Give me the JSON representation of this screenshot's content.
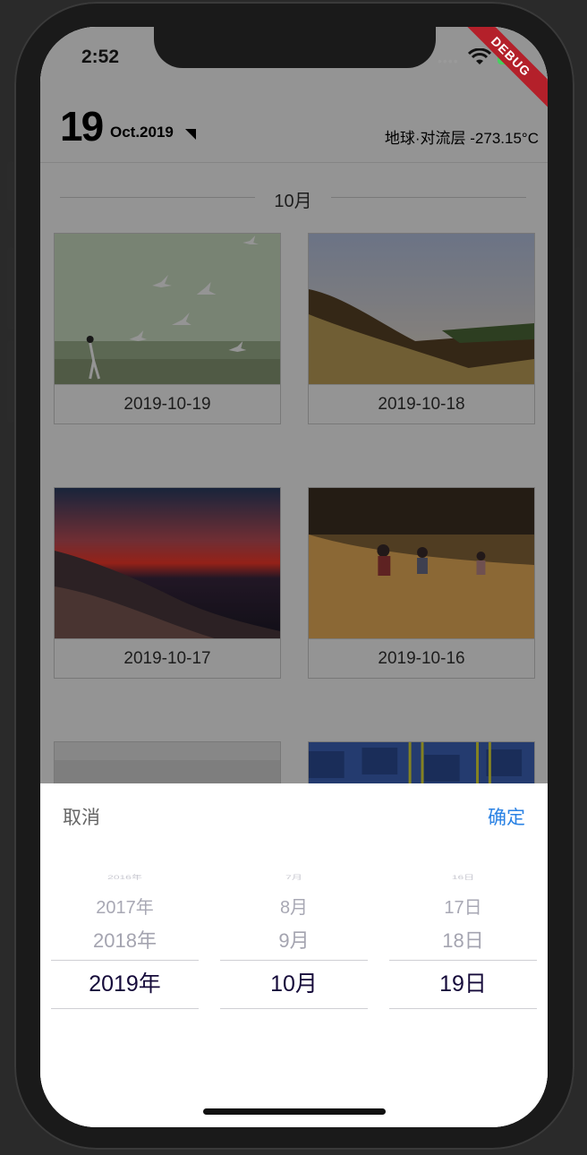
{
  "status_bar": {
    "time": "2:52",
    "signal_dots": "••••",
    "debug_banner": "DEBUG"
  },
  "header": {
    "day": "19",
    "month_year": "Oct.2019",
    "location_temp": "地球·对流层 -273.15°C"
  },
  "month_section": {
    "label": "10月"
  },
  "cards": [
    {
      "date": "2019-10-19",
      "photo": "birds-meadow"
    },
    {
      "date": "2019-10-18",
      "photo": "hillside-sunset"
    },
    {
      "date": "2019-10-17",
      "photo": "ocean-sunset"
    },
    {
      "date": "2019-10-16",
      "photo": "beach-runners"
    },
    {
      "date": "",
      "photo": "foggy-landscape"
    },
    {
      "date": "",
      "photo": "blue-blocks-ladders"
    }
  ],
  "picker": {
    "cancel_label": "取消",
    "confirm_label": "确定",
    "years": [
      "2016年",
      "2017年",
      "2018年",
      "2019年"
    ],
    "months": [
      "7月",
      "8月",
      "9月",
      "10月"
    ],
    "days": [
      "16日",
      "17日",
      "18日",
      "19日"
    ]
  },
  "colors": {
    "confirm_accent": "#2a82e4",
    "selected_text": "#150a3a",
    "debug_banner": "#b4202a"
  }
}
